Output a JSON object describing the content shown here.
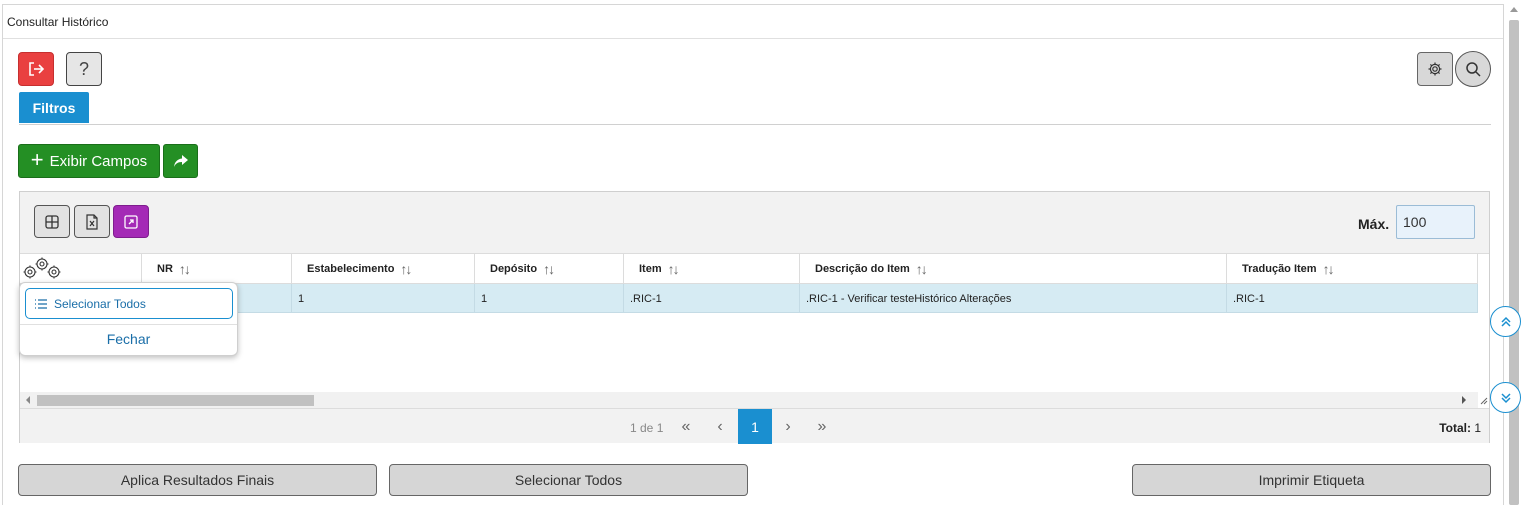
{
  "window": {
    "title": "Consultar Histórico"
  },
  "toolbar": {
    "exit_icon": "exit-icon",
    "help_label": "?",
    "settings_icon": "gear-icon",
    "search_icon": "search-icon"
  },
  "tabs": [
    {
      "label": "Filtros",
      "active": true
    }
  ],
  "actions": {
    "exibir_campos_label": "Exibir Campos",
    "share_icon": "share-icon"
  },
  "grid": {
    "toolbar": {
      "columns_icon": "grid-icon",
      "excel_icon": "excel-icon",
      "expand_icon": "expand-icon",
      "max_label": "Máx.",
      "max_value": "100"
    },
    "columns": [
      {
        "label": ""
      },
      {
        "label": "NR"
      },
      {
        "label": "Estabelecimento"
      },
      {
        "label": "Depósito"
      },
      {
        "label": "Item"
      },
      {
        "label": "Descrição do Item"
      },
      {
        "label": "Tradução Item"
      }
    ],
    "rows": [
      {
        "nr": "",
        "estabelecimento": "1",
        "deposito": "1",
        "item": ".RIC-1",
        "descricao": ".RIC-1 - Verificar testeHistórico Alterações",
        "traducao": ".RIC-1",
        "selected": true
      }
    ],
    "pagination": {
      "info": "1 de 1",
      "first": "«",
      "prev": "‹",
      "current": "1",
      "next": "›",
      "last": "»",
      "total_label": "Total:",
      "total_value": "1"
    }
  },
  "column_menu": {
    "select_all_label": "Selecionar Todos",
    "close_label": "Fechar"
  },
  "bottom_buttons": {
    "aplica_label": "Aplica Resultados Finais",
    "selecionar_label": "Selecionar Todos",
    "imprimir_label": "Imprimir Etiqueta"
  },
  "colors": {
    "primary": "#1a8fd0",
    "danger": "#e94040",
    "success": "#248f24",
    "purple": "#a42ab6",
    "row_selected": "#d6ebf3"
  }
}
